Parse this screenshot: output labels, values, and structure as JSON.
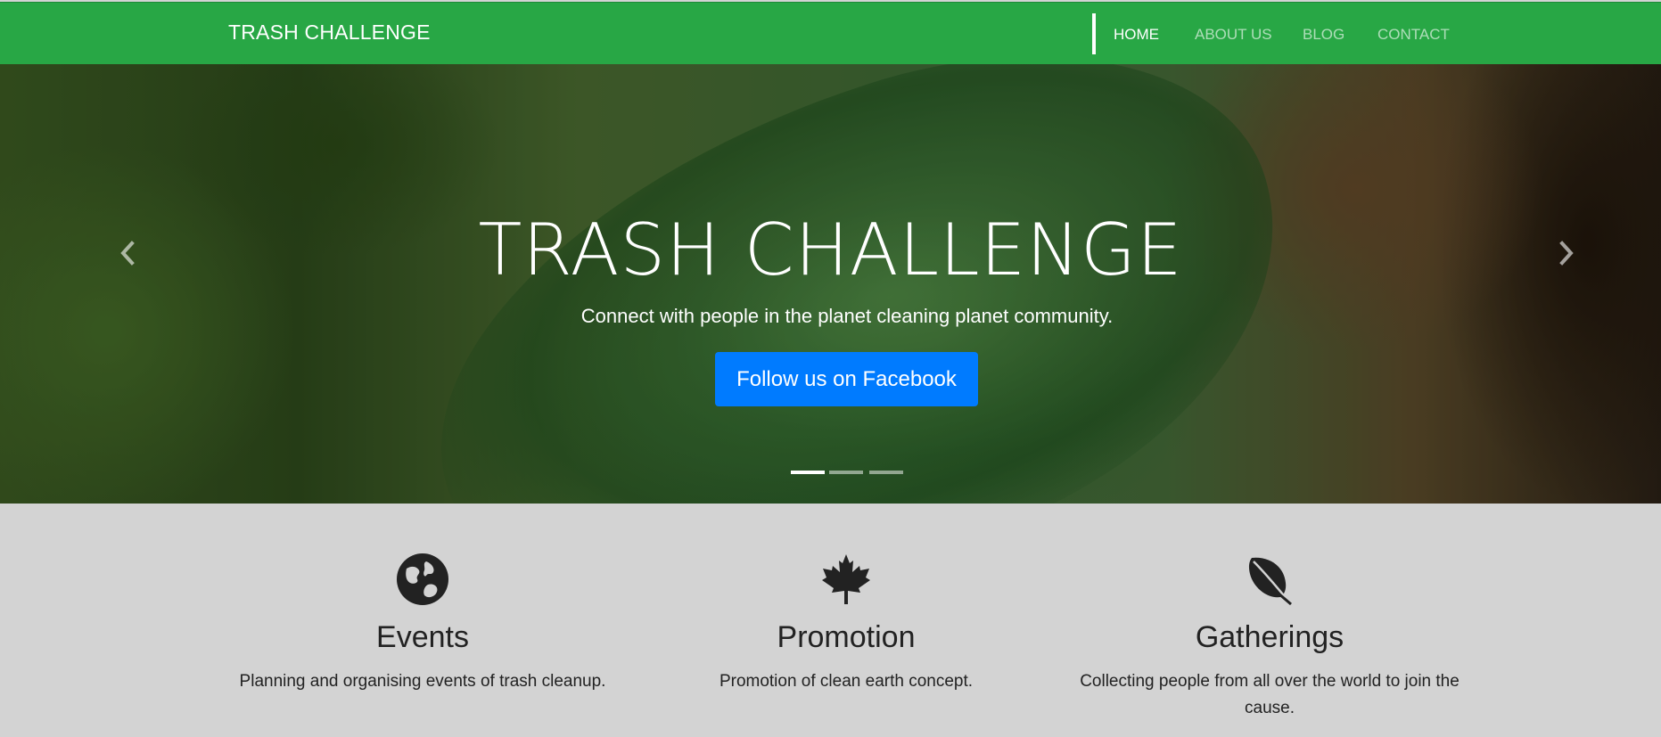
{
  "navbar": {
    "brand": "TRASH CHALLENGE",
    "links": [
      {
        "label": "HOME",
        "active": true
      },
      {
        "label": "ABOUT US",
        "active": false
      },
      {
        "label": "BLOG",
        "active": false
      },
      {
        "label": "CONTACT",
        "active": false
      }
    ],
    "background_color": "#28a745"
  },
  "hero": {
    "title": "TRASH CHALLENGE",
    "subtitle": "Connect with people in the planet cleaning planet community.",
    "button_label": "Follow us on Facebook",
    "button_color": "#007bff",
    "prev_icon": "chevron-left-icon",
    "next_icon": "chevron-right-icon",
    "indicators": [
      {
        "active": true
      },
      {
        "active": false
      },
      {
        "active": false
      }
    ]
  },
  "features": [
    {
      "icon": "globe-icon",
      "title": "Events",
      "text": "Planning and organising events of trash cleanup."
    },
    {
      "icon": "maple-leaf-icon",
      "title": "Promotion",
      "text": "Promotion of clean earth concept."
    },
    {
      "icon": "leaf-icon",
      "title": "Gatherings",
      "text": "Collecting people from all over the world to join the cause."
    }
  ]
}
